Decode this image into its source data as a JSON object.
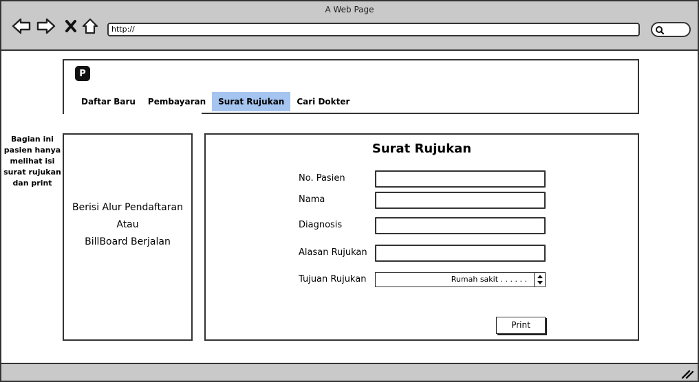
{
  "window": {
    "title": "A Web Page",
    "url": "http://"
  },
  "header": {
    "logo_text": "P",
    "tabs": [
      {
        "label": "Daftar Baru",
        "active": false
      },
      {
        "label": "Pembayaran",
        "active": false
      },
      {
        "label": "Surat Rujukan",
        "active": true
      },
      {
        "label": "Cari Dokter",
        "active": false
      }
    ],
    "active_tab_color": "#a5c4f0"
  },
  "side_note": {
    "line1": "Bagian ini",
    "line2": "pasien hanya",
    "line3": "melihat isi",
    "line4": "surat rujukan",
    "line5": "dan print"
  },
  "left_panel": {
    "line1": "Berisi Alur Pendaftaran",
    "line2": "Atau",
    "line3": "BillBoard Berjalan"
  },
  "form": {
    "title": "Surat Rujukan",
    "fields": [
      {
        "label": "No. Pasien",
        "value": ""
      },
      {
        "label": "Nama",
        "value": ""
      },
      {
        "label": "Diagnosis",
        "value": ""
      },
      {
        "label": "Alasan Rujukan",
        "value": ""
      }
    ],
    "select": {
      "label": "Tujuan Rujukan",
      "value": "Rumah sakit . . . . . ."
    },
    "print_label": "Print"
  },
  "icons": {
    "back": "back-arrow-icon",
    "forward": "forward-arrow-icon",
    "close": "close-icon",
    "home": "home-icon",
    "search": "search-icon",
    "resize": "resize-grip-icon"
  }
}
